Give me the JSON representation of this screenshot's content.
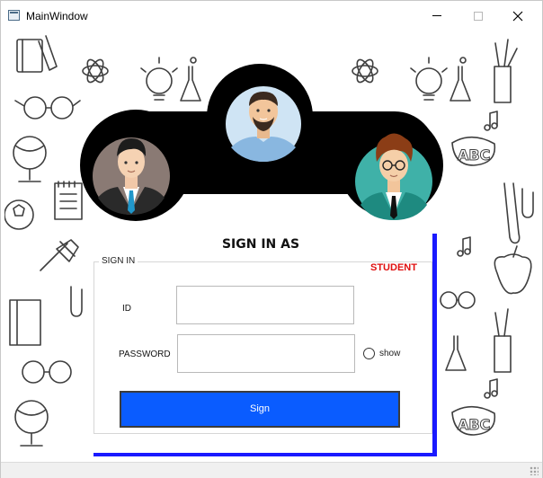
{
  "window": {
    "title": "MainWindow",
    "controls": {
      "minimize_icon": "minimize-icon",
      "maximize_icon": "maximize-icon",
      "close_icon": "close-icon"
    }
  },
  "login": {
    "heading": "SIGN IN AS",
    "selected_role": "STUDENT",
    "groupbox_title": "SIGN IN",
    "id_label": "ID",
    "id_value": "",
    "password_label": "PASSWORD",
    "password_value": "",
    "show_label": "show",
    "show_checked": false,
    "sign_button": "Sign"
  },
  "roles": [
    {
      "name": "avatar-admin",
      "icon": "businessman-avatar"
    },
    {
      "name": "avatar-teacher",
      "icon": "bearded-man-avatar"
    },
    {
      "name": "avatar-student",
      "icon": "student-avatar"
    }
  ],
  "colors": {
    "sign_button": "#0a5cff",
    "panel_shadow": "#1a1aff",
    "selected_role": "#e01010",
    "banner": "#000000",
    "left_avatar_bg": "#8a7a74",
    "center_avatar_bg": "#cfe4f4",
    "right_avatar_bg": "#3fb1a8"
  },
  "background": {
    "pattern": "school-doodle-pattern",
    "text_art": "ABC"
  }
}
